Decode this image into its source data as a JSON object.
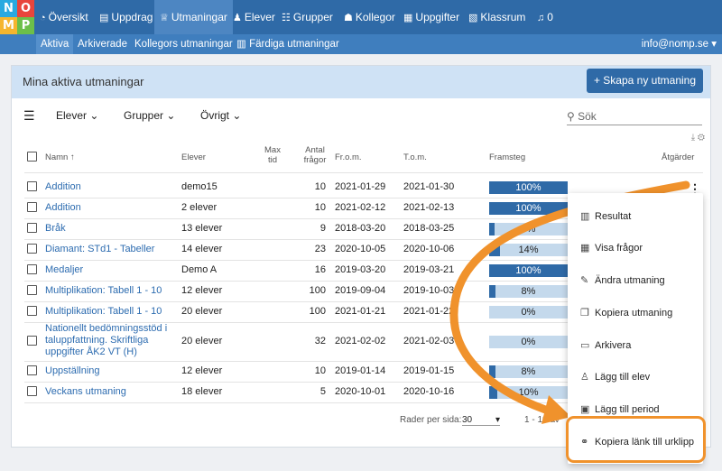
{
  "logo": {
    "letters": [
      "N",
      "O",
      "M",
      "P"
    ]
  },
  "topnav": [
    {
      "label": "Översikt",
      "icon": "dashboard-icon",
      "glyph": "◔"
    },
    {
      "label": "Uppdrag",
      "icon": "book-icon",
      "glyph": "▤"
    },
    {
      "label": "Utmaningar",
      "icon": "trophy-icon",
      "glyph": "♕"
    },
    {
      "label": "Elever",
      "icon": "user-icon",
      "glyph": "♟"
    },
    {
      "label": "Grupper",
      "icon": "group-icon",
      "glyph": "☷"
    },
    {
      "label": "Kollegor",
      "icon": "colleagues-icon",
      "glyph": "☗"
    },
    {
      "label": "Uppgifter",
      "icon": "grid-icon",
      "glyph": "▦"
    },
    {
      "label": "Klassrum",
      "icon": "classroom-icon",
      "glyph": "▧"
    },
    {
      "label": "0",
      "icon": "bell-icon",
      "glyph": "♫"
    }
  ],
  "subnav": [
    {
      "label": "Aktiva"
    },
    {
      "label": "Arkiverade"
    },
    {
      "label": "Kollegors utmaningar"
    },
    {
      "label": "Färdiga utmaningar"
    }
  ],
  "account": {
    "email": "info@nomp.se ▾"
  },
  "card": {
    "title": "Mina aktiva utmaningar",
    "new_button": "+ Skapa ny utmaning"
  },
  "filters": {
    "elever": "Elever",
    "grupper": "Grupper",
    "ovrigt": "Övrigt",
    "search_placeholder": "Sök"
  },
  "table": {
    "headers": {
      "name": "Namn",
      "students": "Elever",
      "max_time_1": "Max",
      "max_time_2": "tid",
      "questions_1": "Antal",
      "questions_2": "frågor",
      "from": "Fr.o.m.",
      "to": "T.o.m.",
      "progress": "Framsteg",
      "actions": "Åtgärder"
    },
    "rows": [
      {
        "name": "Addition",
        "students": "demo15",
        "questions": "10",
        "from": "2021-01-29",
        "to": "2021-01-30",
        "progress": "100%",
        "pct": 1.0
      },
      {
        "name": "Addition",
        "students": "2 elever",
        "questions": "10",
        "from": "2021-02-12",
        "to": "2021-02-13",
        "progress": "100%",
        "pct": 1.0
      },
      {
        "name": "Bråk",
        "students": "13 elever",
        "questions": "9",
        "from": "2018-03-20",
        "to": "2018-03-25",
        "progress": "7%",
        "pct": 0.07
      },
      {
        "name": "Diamant: STd1 - Tabeller",
        "students": "14 elever",
        "questions": "23",
        "from": "2020-10-05",
        "to": "2020-10-06",
        "progress": "14%",
        "pct": 0.14
      },
      {
        "name": "Medaljer",
        "students": "Demo A",
        "questions": "16",
        "from": "2019-03-20",
        "to": "2019-03-21",
        "progress": "100%",
        "pct": 1.0
      },
      {
        "name": "Multiplikation: Tabell 1 - 10",
        "students": "12 elever",
        "questions": "100",
        "from": "2019-09-04",
        "to": "2019-10-03",
        "progress": "8%",
        "pct": 0.08
      },
      {
        "name": "Multiplikation: Tabell 1 - 10",
        "students": "20 elever",
        "questions": "100",
        "from": "2021-01-21",
        "to": "2021-01-22",
        "progress": "0%",
        "pct": 0.0
      },
      {
        "name": "Nationellt bedömningsstöd i taluppfattning. Skriftliga uppgifter ÅK2 VT (H)",
        "students": "20 elever",
        "questions": "32",
        "from": "2021-02-02",
        "to": "2021-02-03",
        "progress": "0%",
        "pct": 0.0
      },
      {
        "name": "Uppställning",
        "students": "12 elever",
        "questions": "10",
        "from": "2019-01-14",
        "to": "2019-01-15",
        "progress": "8%",
        "pct": 0.08
      },
      {
        "name": "Veckans utmaning",
        "students": "18 elever",
        "questions": "5",
        "from": "2020-10-01",
        "to": "2020-10-16",
        "progress": "10%",
        "pct": 0.1
      }
    ]
  },
  "pagination": {
    "rows_per_page_label": "Rader per sida:",
    "rows_per_page": "30",
    "range": "1 - 10 av"
  },
  "menu": [
    {
      "label": "Resultat",
      "icon": "chart-icon",
      "glyph": "▥"
    },
    {
      "label": "Visa frågor",
      "icon": "table-icon",
      "glyph": "▦"
    },
    {
      "label": "Ändra utmaning",
      "icon": "edit-icon",
      "glyph": "✎"
    },
    {
      "label": "Kopiera utmaning",
      "icon": "copy-icon",
      "glyph": "❐"
    },
    {
      "label": "Arkivera",
      "icon": "archive-icon",
      "glyph": "▭"
    },
    {
      "label": "Lägg till elev",
      "icon": "add-user-icon",
      "glyph": "♙"
    },
    {
      "label": "Lägg till period",
      "icon": "calendar-plus-icon",
      "glyph": "▣"
    },
    {
      "label": "Kopiera länk till urklipp",
      "icon": "link-icon",
      "glyph": "⚭"
    }
  ],
  "colors": {
    "primary": "#2f6aa7",
    "highlight": "#f0922c",
    "progress_bg": "#c4d9ec"
  }
}
